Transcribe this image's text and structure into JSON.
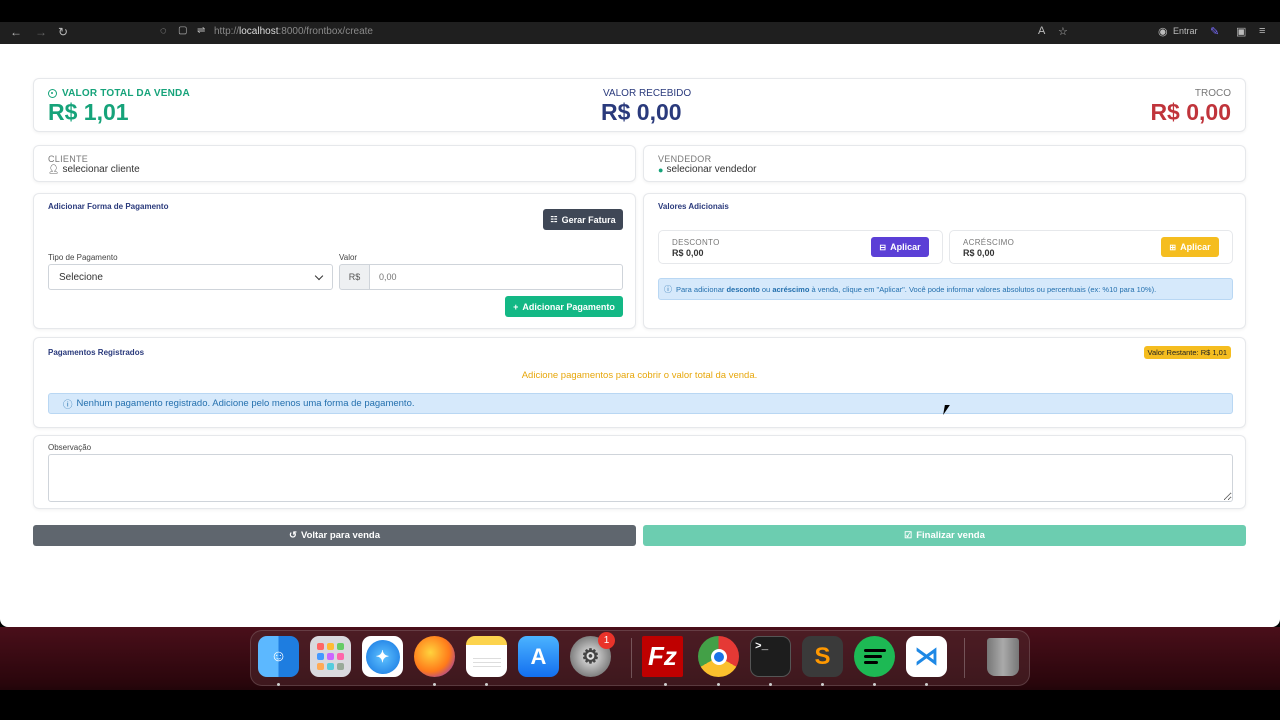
{
  "browser": {
    "url_prefix": "http://",
    "url_host": "localhost",
    "url_rest": ":8000/frontbox/create",
    "profile_label": "Entrar"
  },
  "summary": {
    "total_label": "VALOR TOTAL DA VENDA",
    "total_value": "R$ 1,01",
    "received_label": "VALOR RECEBIDO",
    "received_value": "R$ 0,00",
    "change_label": "TROCO",
    "change_value": "R$ 0,00"
  },
  "client": {
    "label": "CLIENTE",
    "value": "selecionar cliente"
  },
  "seller": {
    "label": "VENDEDOR",
    "value": "selecionar vendedor"
  },
  "payment_form": {
    "title": "Adicionar Forma de Pagamento",
    "invoice_button": "Gerar Fatura",
    "type_label": "Tipo de Pagamento",
    "type_selected": "Selecione",
    "value_label": "Valor",
    "currency_prefix": "R$",
    "value_placeholder": "0,00",
    "add_button": "Adicionar Pagamento"
  },
  "additional": {
    "title": "Valores Adicionais",
    "discount_label": "DESCONTO",
    "discount_value": "R$ 0,00",
    "discount_button": "Aplicar",
    "surcharge_label": "ACRÉSCIMO",
    "surcharge_value": "R$ 0,00",
    "surcharge_button": "Aplicar",
    "info_part1": "Para adicionar ",
    "info_bold1": "desconto",
    "info_part2": " ou ",
    "info_bold2": "acréscimo",
    "info_part3": " à venda, clique em \"Aplicar\". Você pode informar valores absolutos ou percentuais (ex: %10 para 10%)."
  },
  "registered": {
    "title": "Pagamentos Registrados",
    "remaining_badge": "Valor Restante: R$ 1,01",
    "warning": "Adicione pagamentos para cobrir o valor total da venda.",
    "empty_info": "Nenhum pagamento registrado. Adicione pelo menos uma forma de pagamento."
  },
  "observation": {
    "label": "Observação"
  },
  "actions": {
    "back_button": "Voltar para venda",
    "finish_button": "Finalizar venda"
  },
  "dock": {
    "apps": [
      "finder-icon",
      "launchpad-icon",
      "safari-icon",
      "firefox-icon",
      "notes-icon",
      "app-store-icon",
      "system-settings-icon",
      "filezilla-icon",
      "chrome-icon",
      "terminal-icon",
      "sublime-icon",
      "spotify-icon",
      "vscode-icon",
      "trash-icon"
    ],
    "settings_badge": "1"
  },
  "colors": {
    "green": "#16a37a",
    "navy": "#2a3a7c",
    "red": "#c0343b",
    "purple": "#5b3fd6",
    "yellow": "#f5bd1f",
    "teal_button": "#13b885",
    "dark_button": "#3f4756"
  }
}
